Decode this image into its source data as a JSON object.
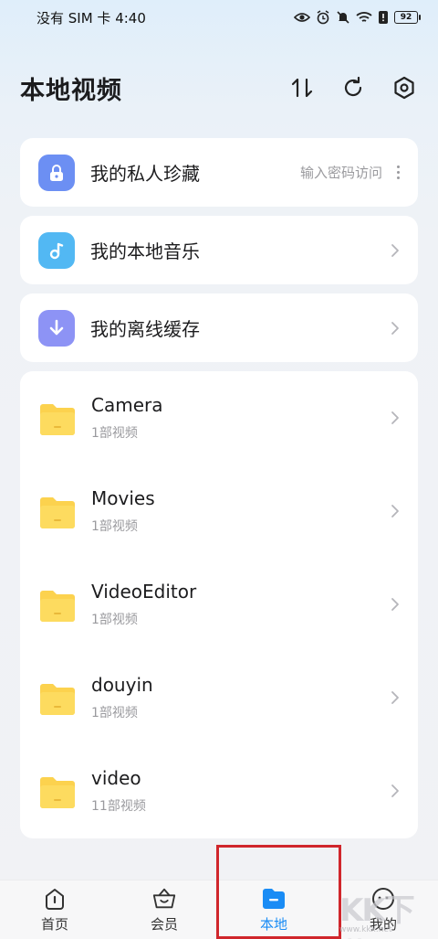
{
  "status_bar": {
    "carrier": "没有 SIM 卡 4:40",
    "battery": "92"
  },
  "header": {
    "title": "本地视频"
  },
  "special_rows": [
    {
      "title": "我的私人珍藏",
      "hint": "输入密码访问",
      "icon": "lock-icon",
      "color": "#6c8ff3"
    },
    {
      "title": "我的本地音乐",
      "icon": "music-note-icon",
      "color": "#52b8f3"
    },
    {
      "title": "我的离线缓存",
      "icon": "download-icon",
      "color": "#8d93f5"
    }
  ],
  "folders": [
    {
      "name": "Camera",
      "count": "1部视频"
    },
    {
      "name": "Movies",
      "count": "1部视频"
    },
    {
      "name": "VideoEditor",
      "count": "1部视频"
    },
    {
      "name": "douyin",
      "count": "1部视频"
    },
    {
      "name": "video",
      "count": "11部视频"
    }
  ],
  "tabs": [
    {
      "label": "首页",
      "icon": "home-icon"
    },
    {
      "label": "会员",
      "icon": "crown-basket-icon"
    },
    {
      "label": "本地",
      "icon": "folder-icon",
      "active": true
    },
    {
      "label": "我的",
      "icon": "profile-icon"
    }
  ],
  "colors": {
    "accent": "#1a8cf5",
    "folder": "#fcd24e",
    "highlight": "#d0262c"
  },
  "watermark": {
    "text": "KK下载",
    "url": "www.kkx.net"
  }
}
